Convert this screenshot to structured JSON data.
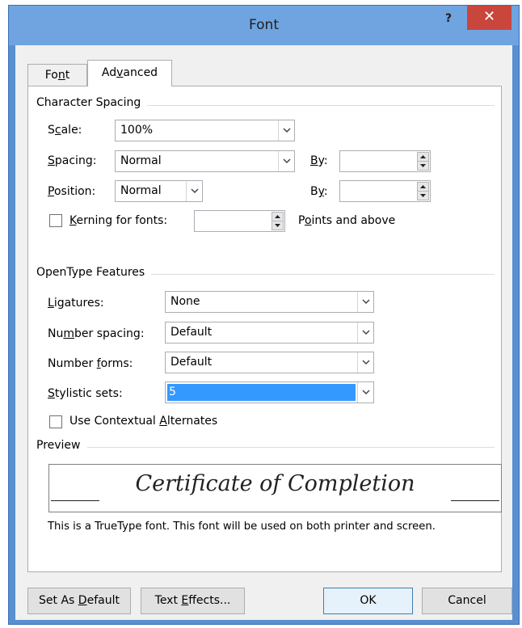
{
  "window": {
    "title": "Font",
    "help": "?",
    "close": "✕"
  },
  "tabs": [
    {
      "label_pre": "Fo",
      "label_u": "n",
      "label_post": "t"
    },
    {
      "label_pre": "Ad",
      "label_u": "v",
      "label_post": "anced"
    }
  ],
  "character_spacing": {
    "group_title": "Character Spacing",
    "scale": {
      "label_pre": "S",
      "label_u": "c",
      "label_post": "ale:",
      "value": "100%"
    },
    "spacing": {
      "label_pre": "",
      "label_u": "S",
      "label_post": "pacing:",
      "value": "Normal"
    },
    "spacing_by": {
      "label_pre": "",
      "label_u": "B",
      "label_post": "y:",
      "value": ""
    },
    "position": {
      "label_pre": "",
      "label_u": "P",
      "label_post": "osition:",
      "value": "Normal"
    },
    "position_by": {
      "label_pre": "B",
      "label_u": "y",
      "label_post": ":",
      "value": ""
    },
    "kerning": {
      "label_pre": "",
      "label_u": "K",
      "label_post": "erning for fonts:",
      "checked": false,
      "value": ""
    },
    "points_label": {
      "pre": "P",
      "u": "o",
      "post": "ints and above"
    }
  },
  "opentype": {
    "group_title": "OpenType Features",
    "ligatures": {
      "label_pre": "",
      "label_u": "L",
      "label_post": "igatures:",
      "value": "None"
    },
    "number_spacing": {
      "label_pre": "Nu",
      "label_u": "m",
      "label_post": "ber spacing:",
      "value": "Default"
    },
    "number_forms": {
      "label_pre": "Number ",
      "label_u": "f",
      "label_post": "orms:",
      "value": "Default"
    },
    "stylistic_sets": {
      "label_pre": "",
      "label_u": "S",
      "label_post": "tylistic sets:",
      "value": "5"
    },
    "contextual": {
      "label_pre": "Use Contextual ",
      "label_u": "A",
      "label_post": "lternates",
      "checked": false
    }
  },
  "preview": {
    "group_title": "Preview",
    "sample_text": "Certificate of Completion",
    "note": "This is a TrueType font. This font will be used on both printer and screen."
  },
  "buttons": {
    "set_default": {
      "pre": "Set As ",
      "u": "D",
      "post": "efault"
    },
    "text_effects": {
      "pre": "Text ",
      "u": "E",
      "post": "ffects..."
    },
    "ok": "OK",
    "cancel": "Cancel"
  },
  "colors": {
    "titlebar": "#6fa4e0",
    "close": "#c9463d",
    "selection": "#3399ff"
  }
}
